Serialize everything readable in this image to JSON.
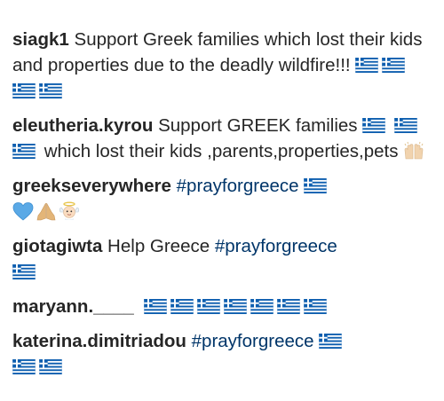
{
  "comments": [
    {
      "username": "siagk1",
      "text": " Support Greek families which lost their kids and properties due to the deadly wildfire!!! ",
      "emojis": [
        "greek-flag",
        "greek-flag",
        "greek-flag",
        "greek-flag"
      ]
    },
    {
      "username": "eleutheria.kyrou",
      "text_part1": " Support GREEK families ",
      "text_part2": " which lost their kids ,parents,properties,pets ",
      "emojis": [
        "greek-flag",
        "greek-flag",
        "greek-flag",
        "raised-hands"
      ]
    },
    {
      "username": "greekseverywhere",
      "hashtag": "#prayforgreece",
      "emojis": [
        "greek-flag",
        "blue-heart",
        "folded-hands",
        "baby-angel"
      ]
    },
    {
      "username": "giotagiwta",
      "text": " Help Greece ",
      "hashtag": "#prayforgreece",
      "emojis": [
        "greek-flag"
      ]
    },
    {
      "username": "maryann.____",
      "emojis": [
        "greek-flag",
        "greek-flag",
        "greek-flag",
        "greek-flag",
        "greek-flag",
        "greek-flag",
        "greek-flag"
      ]
    },
    {
      "username": "katerina.dimitriadou",
      "hashtag": "#prayforgreece",
      "emojis": [
        "greek-flag",
        "greek-flag",
        "greek-flag"
      ]
    }
  ],
  "colors": {
    "text": "#262626",
    "hashtag": "#003569",
    "flag_blue": "#0D5EAF",
    "heart_blue": "#5AA9E6"
  }
}
